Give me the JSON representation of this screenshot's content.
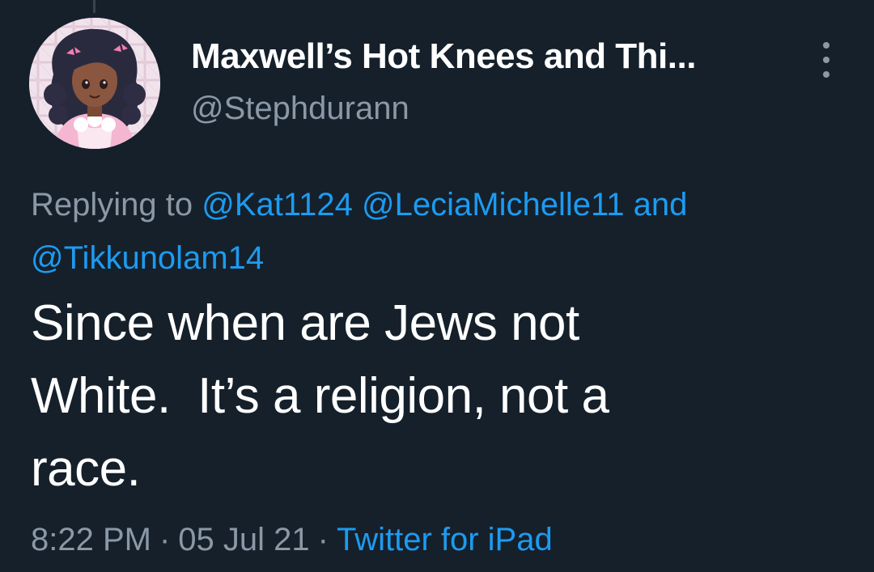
{
  "author": {
    "display_name": "Maxwell’s Hot Knees and Thi...",
    "handle": "@Stephdurann",
    "avatar_icon": "cartoon-girl-avatar"
  },
  "reply_context": {
    "prefix": "Replying to",
    "mentions": [
      "@Kat1124",
      "@LeciaMichelle11",
      "@Tikkunolam14"
    ],
    "conjunction": "and"
  },
  "tweet": {
    "text": "Since when are Jews not\nWhite.  It’s a religion, not a\nrace."
  },
  "meta": {
    "time": "8:22 PM",
    "separator": "·",
    "date": "05 Jul 21",
    "source": "Twitter for iPad"
  },
  "menu": {
    "icon": "more-vertical-icon"
  },
  "colors": {
    "background": "#15202b",
    "primary_text": "#ffffff",
    "secondary_text": "#8b98a5",
    "link": "#1d9bf0"
  }
}
